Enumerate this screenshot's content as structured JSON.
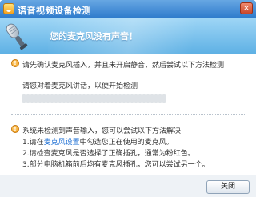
{
  "window": {
    "title": "语音视频设备检测",
    "close_glyph": "×"
  },
  "banner": {
    "message": "您的麦克风没有声音！"
  },
  "content": {
    "instruction": "请先确认麦克风插入，并且未开启静音，然后尝试以下方法检测",
    "prompt": "请您对着麦克风讲话，以便开始检测",
    "level_fraction": 0,
    "help_intro": "系统未检测到声音输入，您可以尝试以下方法解决:",
    "help_items": [
      {
        "prefix": "1.请在",
        "link": "麦克风设置",
        "suffix": "中勾选您正在使用的麦克风。"
      },
      {
        "text": "2.请检查麦克风是否选择了正确插孔，通常为粉红色。"
      },
      {
        "text": "3.部分电脑机箱前后均有麦克风插孔，您可以尝试另一个。"
      }
    ]
  },
  "footer": {
    "close_label": "关闭"
  },
  "colors": {
    "titlebar": "#2f7ccc",
    "banner": "#5db0e4",
    "link": "#1a6dd3",
    "info_icon": "#f29b16"
  }
}
